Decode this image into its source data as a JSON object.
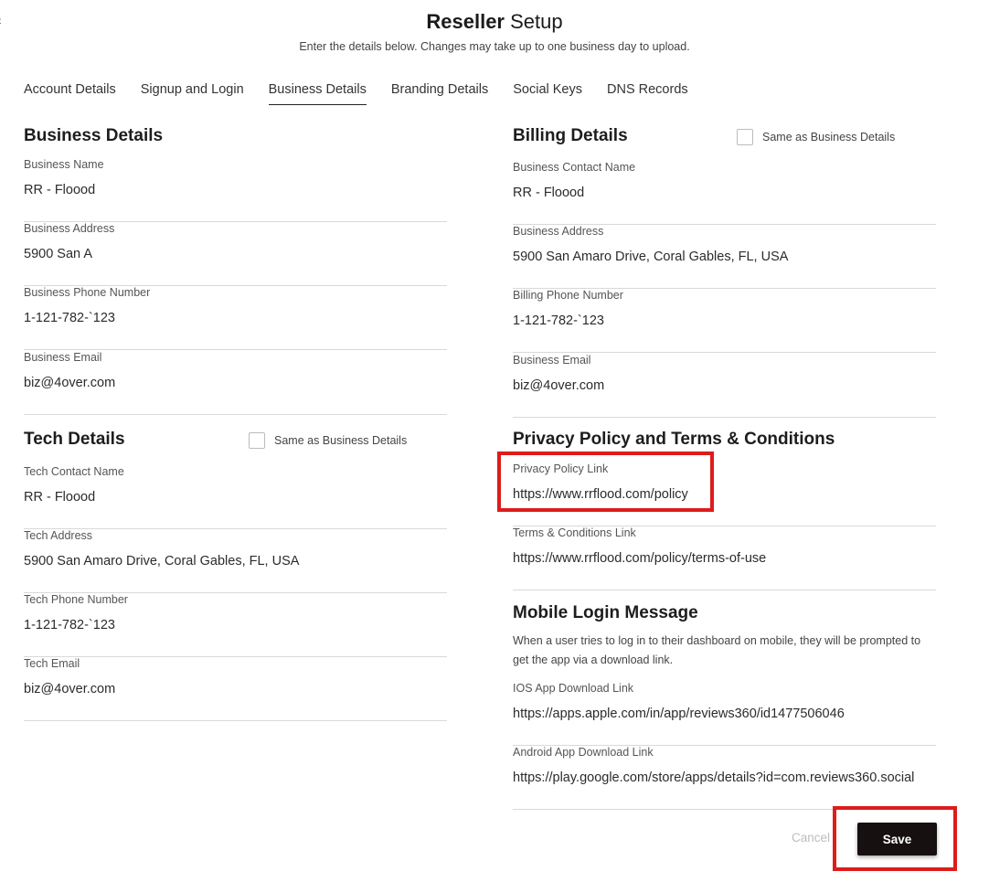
{
  "header": {
    "title_bold": "Reseller",
    "title_rest": "Setup",
    "subtitle": "Enter the details below. Changes may take up to one business day to upload."
  },
  "tabs": [
    {
      "label": "Account Details",
      "active": false
    },
    {
      "label": "Signup and Login",
      "active": false
    },
    {
      "label": "Business Details",
      "active": true
    },
    {
      "label": "Branding Details",
      "active": false
    },
    {
      "label": "Social Keys",
      "active": false
    },
    {
      "label": "DNS Records",
      "active": false
    }
  ],
  "business": {
    "title": "Business Details",
    "fields": [
      {
        "label": "Business Name",
        "value": "RR - Floood"
      },
      {
        "label": "Business Address",
        "value": "5900 San A"
      },
      {
        "label": "Business Phone Number",
        "value": "1-121-782-`123"
      },
      {
        "label": "Business Email",
        "value": "biz@4over.com"
      }
    ]
  },
  "tech": {
    "title": "Tech Details",
    "same_as_label": "Same as Business Details",
    "same_as_checked": false,
    "fields": [
      {
        "label": "Tech Contact Name",
        "value": "RR - Floood"
      },
      {
        "label": "Tech Address",
        "value": "5900 San Amaro Drive, Coral Gables, FL, USA"
      },
      {
        "label": "Tech Phone Number",
        "value": "1-121-782-`123"
      },
      {
        "label": "Tech Email",
        "value": "biz@4over.com"
      }
    ]
  },
  "billing": {
    "title": "Billing Details",
    "same_as_label": "Same as Business Details",
    "same_as_checked": false,
    "fields": [
      {
        "label": "Business Contact Name",
        "value": "RR - Floood"
      },
      {
        "label": "Business Address",
        "value": "5900 San Amaro Drive, Coral Gables, FL, USA"
      },
      {
        "label": "Billing Phone Number",
        "value": "1-121-782-`123"
      },
      {
        "label": "Business Email",
        "value": "biz@4over.com"
      }
    ]
  },
  "privacy": {
    "title": "Privacy Policy and Terms & Conditions",
    "fields": [
      {
        "label": "Privacy Policy Link",
        "value": "https://www.rrflood.com/policy"
      },
      {
        "label": "Terms & Conditions Link",
        "value": "https://www.rrflood.com/policy/terms-of-use"
      }
    ]
  },
  "mobile": {
    "title": "Mobile Login Message",
    "description": "When a user tries to log in to their dashboard on mobile, they will be prompted to get the app via a download link.",
    "fields": [
      {
        "label": "IOS App Download Link",
        "value": "https://apps.apple.com/in/app/reviews360/id1477506046"
      },
      {
        "label": "Android App Download Link",
        "value": "https://play.google.com/store/apps/details?id=com.reviews360.social"
      }
    ]
  },
  "actions": {
    "cancel_label": "Cancel",
    "save_label": "Save"
  },
  "colors": {
    "highlight": "#dd1c1c",
    "save_button_bg": "#161010",
    "divider": "#d9d9d9"
  }
}
